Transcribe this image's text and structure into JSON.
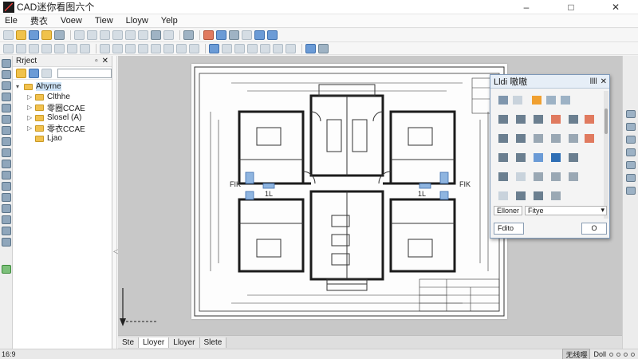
{
  "titlebar": {
    "title": "CAD迷你看图六个",
    "controls": {
      "minimize": "–",
      "maximize": "□",
      "close": "✕"
    }
  },
  "menu": [
    "Ele",
    "费衣",
    "Voew",
    "Tiew",
    "Lloyw",
    "Yelp"
  ],
  "project": {
    "title": "Rrject",
    "controls": {
      "pin": "▫",
      "close": "✕"
    },
    "search_placeholder": "",
    "tree": [
      {
        "label": "Ahyrne",
        "expander": "▾",
        "selected": true
      },
      {
        "label": "Clthhe",
        "expander": "▷"
      },
      {
        "label": "零圈CCAE",
        "expander": "▷"
      },
      {
        "label": "Slosel (A)",
        "expander": "▷"
      },
      {
        "label": "零衣CCAE",
        "expander": "▷"
      },
      {
        "label": "Ljao",
        "expander": ""
      }
    ]
  },
  "drawing": {
    "room_label_left": "FIK",
    "room_label_right": "FIK",
    "cell_label_left": "1L",
    "cell_label_right": "1L"
  },
  "sheet_tabs": [
    "Ste",
    "Lloyer",
    "Lloyer",
    "Slete"
  ],
  "palette": {
    "title": "Lldi 嗷嗷",
    "controls": {
      "pin": "llll",
      "close": "✕"
    },
    "tab": "Elloner",
    "select_value": "Fitye",
    "left_button": "Fdito",
    "right_button": "O"
  },
  "status": {
    "ratio": "16:9",
    "chip": "无线嘤",
    "label": "Doll"
  },
  "colors": {
    "accent": "#2f6fb5",
    "wall": "#1c1c1c",
    "water_blue": "#8fb5e0",
    "canvas_bg": "#c8c8c8"
  }
}
